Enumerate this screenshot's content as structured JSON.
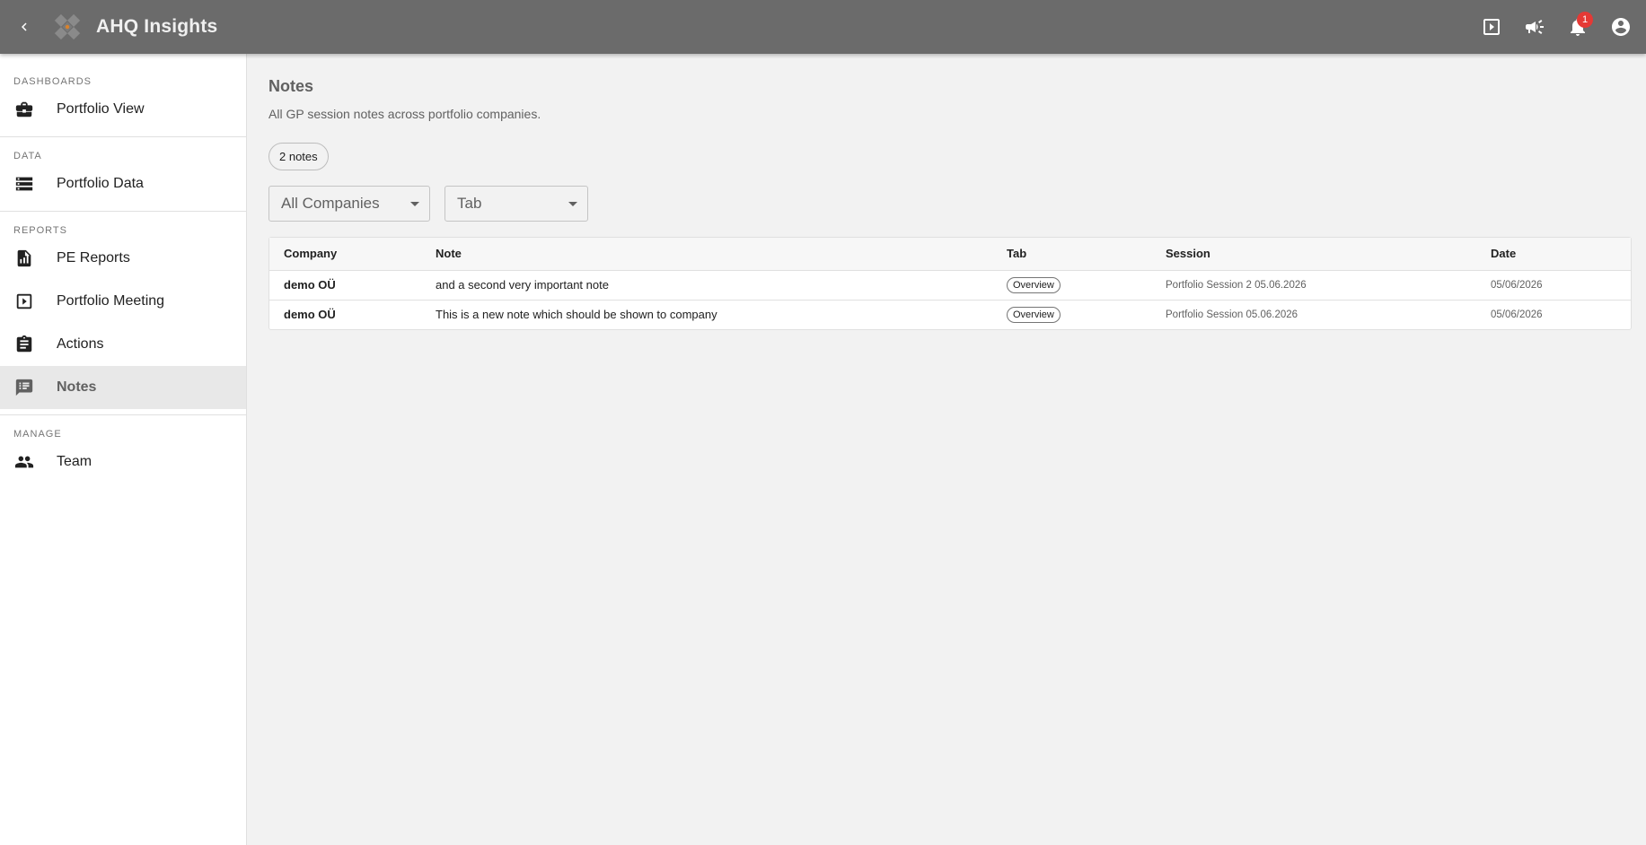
{
  "header": {
    "app_title": "AHQ Insights",
    "notification_count": "1",
    "icons": [
      "back-icon",
      "logo",
      "slideshow-icon",
      "announcement-icon",
      "bell-icon",
      "account-icon"
    ],
    "colors": {
      "bar": "#6b6b6b",
      "badge": "#e53935"
    }
  },
  "sidebar": {
    "sections": [
      {
        "label": "DASHBOARDS",
        "items": [
          {
            "label": "Portfolio View",
            "icon": "briefcase-icon"
          }
        ]
      },
      {
        "label": "DATA",
        "items": [
          {
            "label": "Portfolio Data",
            "icon": "storage-icon"
          }
        ]
      },
      {
        "label": "REPORTS",
        "items": [
          {
            "label": "PE Reports",
            "icon": "report-icon"
          },
          {
            "label": "Portfolio Meeting",
            "icon": "slideshow-icon"
          },
          {
            "label": "Actions",
            "icon": "assignment-icon"
          },
          {
            "label": "Notes",
            "icon": "notes-icon",
            "active": true
          }
        ]
      },
      {
        "label": "MANAGE",
        "items": [
          {
            "label": "Team",
            "icon": "people-icon"
          }
        ]
      }
    ]
  },
  "main": {
    "title": "Notes",
    "subtitle": "All GP session notes across portfolio companies.",
    "count_label": "2 notes",
    "filters": {
      "company": "All Companies",
      "tab": "Tab"
    },
    "table": {
      "headers": {
        "company": "Company",
        "note": "Note",
        "tab": "Tab",
        "session": "Session",
        "date": "Date"
      },
      "rows": [
        {
          "company": "demo OÜ",
          "note": "and a second very important note",
          "tab": "Overview",
          "session": "Portfolio Session 2 05.06.2026",
          "date": "05/06/2026"
        },
        {
          "company": "demo OÜ",
          "note": "This is a new note which should be shown to company",
          "tab": "Overview",
          "session": "Portfolio Session 05.06.2026",
          "date": "05/06/2026"
        }
      ]
    }
  }
}
